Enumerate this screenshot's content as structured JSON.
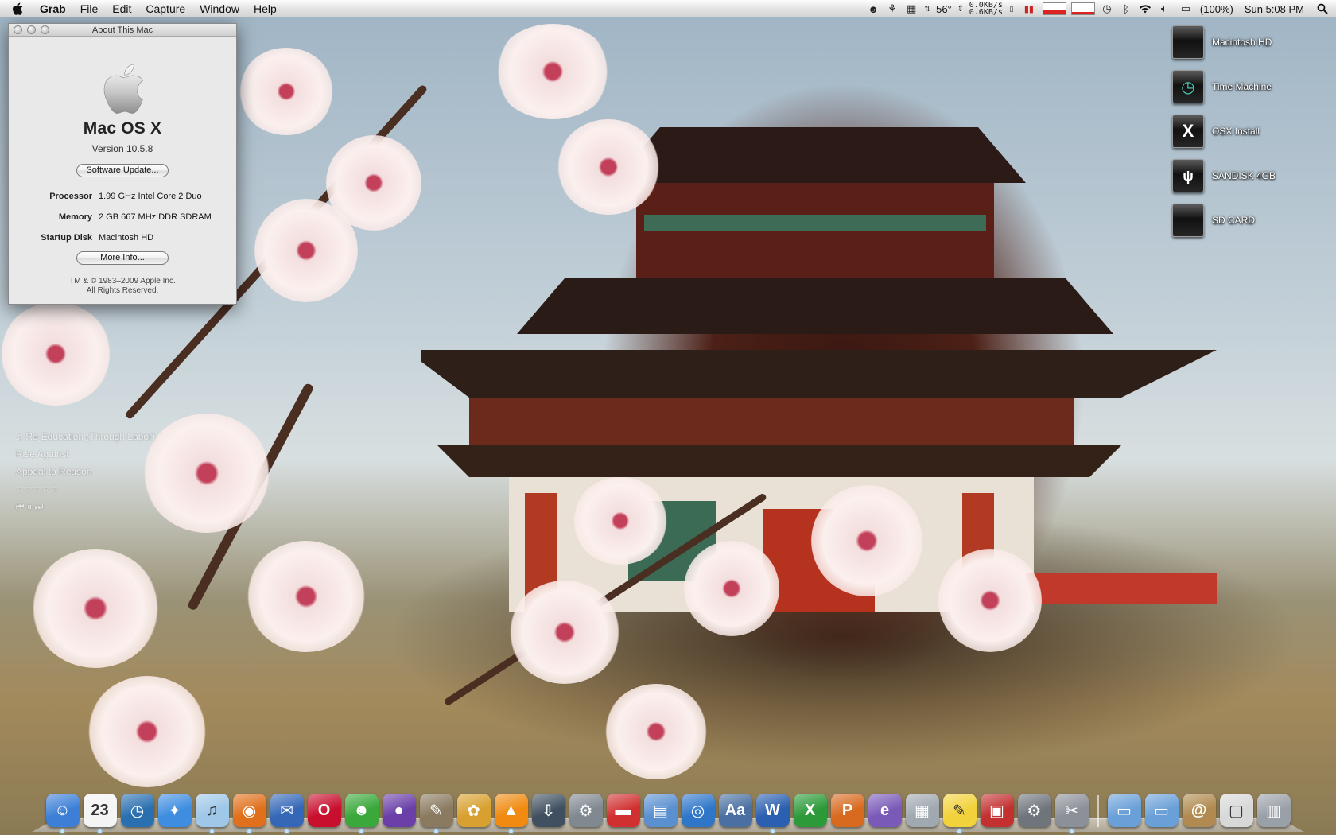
{
  "menubar": {
    "app_name": "Grab",
    "menus": [
      "File",
      "Edit",
      "Capture",
      "Window",
      "Help"
    ],
    "temperature": "56°",
    "network_up": "0.0KB/s",
    "network_down": "0.6KB/s",
    "battery": "(100%)",
    "clock": "Sun 5:08 PM"
  },
  "about_window": {
    "title": "About This Mac",
    "os_name": "Mac OS X",
    "version": "Version 10.5.8",
    "software_update_label": "Software Update...",
    "specs": [
      {
        "label": "Processor",
        "value": "1.99 GHz Intel Core 2 Duo"
      },
      {
        "label": "Memory",
        "value": "2 GB 667 MHz DDR SDRAM"
      },
      {
        "label": "Startup Disk",
        "value": "Macintosh HD"
      }
    ],
    "more_info_label": "More Info...",
    "copyright_line1": "TM & © 1983–2009 Apple Inc.",
    "copyright_line2": "All Rights Reserved."
  },
  "desktop_volumes": [
    {
      "label": "Macintosh HD",
      "icon": "apple-drive-icon"
    },
    {
      "label": "Time Machine",
      "icon": "time-machine-drive-icon"
    },
    {
      "label": "OSX Install",
      "icon": "x-drive-icon"
    },
    {
      "label": "SANDISK 4GB",
      "icon": "usb-drive-icon"
    },
    {
      "label": "SD CARD",
      "icon": "sd-card-icon"
    }
  ],
  "now_playing": {
    "track": "♫ Re-Education (Through Labor)",
    "artist": "Rise Against",
    "album": "Appeal to Reason",
    "rating": "☆☆☆☆☆",
    "controls": "⏮ ⏸ ⏭"
  },
  "dock": {
    "apps": [
      {
        "name": "finder",
        "glyph": "☺",
        "color": "#3d7fd6"
      },
      {
        "name": "ical",
        "glyph": "23",
        "color": "#f4f4f4"
      },
      {
        "name": "time-machine",
        "glyph": "◷",
        "color": "#2a6fb0"
      },
      {
        "name": "safari",
        "glyph": "✦",
        "color": "#3f8de0"
      },
      {
        "name": "itunes",
        "glyph": "♫",
        "color": "#9fc7e8"
      },
      {
        "name": "firefox",
        "glyph": "◉",
        "color": "#e0701c"
      },
      {
        "name": "thunderbird",
        "glyph": "✉",
        "color": "#3567b8"
      },
      {
        "name": "opera",
        "glyph": "O",
        "color": "#c8102e"
      },
      {
        "name": "adium",
        "glyph": "☻",
        "color": "#3aa83a"
      },
      {
        "name": "gimp-ball",
        "glyph": "●",
        "color": "#6a3fa8"
      },
      {
        "name": "gimp",
        "glyph": "✎",
        "color": "#8a7a60"
      },
      {
        "name": "cocktail",
        "glyph": "✿",
        "color": "#d8a030"
      },
      {
        "name": "vlc",
        "glyph": "▲",
        "color": "#f08a10"
      },
      {
        "name": "bittorrent",
        "glyph": "⇩",
        "color": "#405060"
      },
      {
        "name": "utility",
        "glyph": "⚙",
        "color": "#808890"
      },
      {
        "name": "toolbox",
        "glyph": "▬",
        "color": "#d03030"
      },
      {
        "name": "preview",
        "glyph": "▤",
        "color": "#5a8fd0"
      },
      {
        "name": "app-store-like",
        "glyph": "◎",
        "color": "#2f76c9"
      },
      {
        "name": "dictionary",
        "glyph": "Aa",
        "color": "#4a6fa0"
      },
      {
        "name": "word",
        "glyph": "W",
        "color": "#2b5fb0"
      },
      {
        "name": "excel",
        "glyph": "X",
        "color": "#2d9a3a"
      },
      {
        "name": "powerpoint",
        "glyph": "P",
        "color": "#d86a20"
      },
      {
        "name": "entourage",
        "glyph": "e",
        "color": "#7a5ab8"
      },
      {
        "name": "calculator-doc",
        "glyph": "▦",
        "color": "#a0a8b0"
      },
      {
        "name": "stickies",
        "glyph": "✎",
        "color": "#f2d23c"
      },
      {
        "name": "parallels",
        "glyph": "▣",
        "color": "#c23030"
      },
      {
        "name": "system-preferences",
        "glyph": "⚙",
        "color": "#70757c"
      },
      {
        "name": "grab",
        "glyph": "✂",
        "color": "#8c9098"
      }
    ],
    "stacks": [
      {
        "name": "applications-folder",
        "glyph": "▭",
        "color": "#6aa0d8"
      },
      {
        "name": "documents-folder",
        "glyph": "▭",
        "color": "#6aa0d8"
      },
      {
        "name": "address-book",
        "glyph": "@",
        "color": "#b08a50"
      },
      {
        "name": "downloads-stack",
        "glyph": "▢",
        "color": "#d8d8d8"
      },
      {
        "name": "trash",
        "glyph": "▥",
        "color": "#9aa0a8"
      }
    ]
  }
}
